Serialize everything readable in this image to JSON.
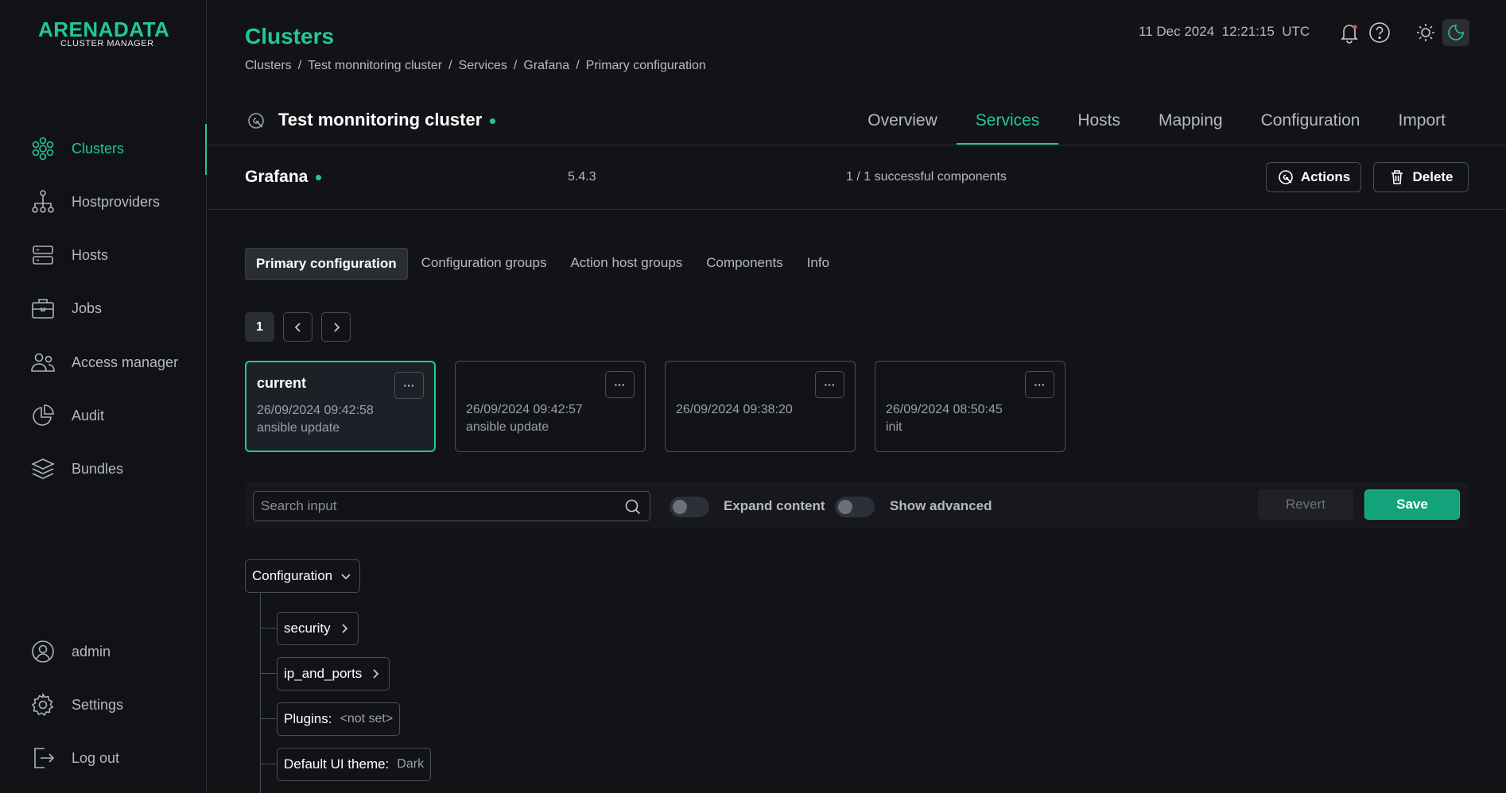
{
  "app": {
    "logo_main": "ARENADATA",
    "logo_sub": "CLUSTER MANAGER",
    "accent_color": "#20c997"
  },
  "sidebar": {
    "items": [
      {
        "label": "Clusters",
        "icon": "clusters-icon",
        "active": true
      },
      {
        "label": "Hostproviders",
        "icon": "hostproviders-icon"
      },
      {
        "label": "Hosts",
        "icon": "hosts-icon"
      },
      {
        "label": "Jobs",
        "icon": "jobs-icon"
      },
      {
        "label": "Access manager",
        "icon": "access-manager-icon"
      },
      {
        "label": "Audit",
        "icon": "audit-icon"
      },
      {
        "label": "Bundles",
        "icon": "bundles-icon"
      }
    ],
    "bottom_items": [
      {
        "label": "admin",
        "icon": "user-icon"
      },
      {
        "label": "Settings",
        "icon": "gear-icon"
      },
      {
        "label": "Log out",
        "icon": "logout-icon"
      }
    ]
  },
  "header": {
    "title": "Clusters",
    "breadcrumb": [
      "Clusters",
      "Test monnitoring cluster",
      "Services",
      "Grafana",
      "Primary configuration"
    ],
    "date": "11 Dec 2024",
    "time": "12:21:15",
    "timezone": "UTC"
  },
  "cluster": {
    "name": "Test monnitoring cluster",
    "tabs": [
      "Overview",
      "Services",
      "Hosts",
      "Mapping",
      "Configuration",
      "Import"
    ],
    "active_tab": "Services"
  },
  "service": {
    "name": "Grafana",
    "version": "5.4.3",
    "components": "1 / 1 successful components",
    "actions_label": "Actions",
    "delete_label": "Delete"
  },
  "subtabs": [
    "Primary configuration",
    "Configuration groups",
    "Action host groups",
    "Components",
    "Info"
  ],
  "pagination": {
    "current": "1"
  },
  "config_versions": [
    {
      "title": "current",
      "date": "26/09/2024 09:42:58",
      "description": "ansible update",
      "selected": true
    },
    {
      "title": "",
      "date": "26/09/2024 09:42:57",
      "description": "ansible update"
    },
    {
      "title": "",
      "date": "26/09/2024 09:38:20",
      "description": ""
    },
    {
      "title": "",
      "date": "26/09/2024 08:50:45",
      "description": "init"
    }
  ],
  "toolbar": {
    "search_placeholder": "Search input",
    "expand_label": "Expand content",
    "advanced_label": "Show advanced",
    "revert_label": "Revert",
    "save_label": "Save"
  },
  "tree": {
    "root": "Configuration",
    "nodes": [
      {
        "label": "security",
        "value": ""
      },
      {
        "label": "ip_and_ports",
        "value": ""
      },
      {
        "label": "Plugins:",
        "value": "<not set>"
      },
      {
        "label": "Default UI theme:",
        "value": "Dark"
      }
    ]
  }
}
